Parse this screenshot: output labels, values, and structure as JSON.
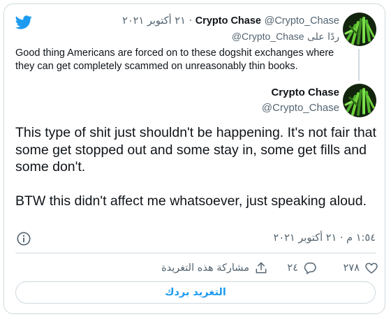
{
  "quoted_tweet": {
    "author_name": "Crypto Chase",
    "author_handle": "@Crypto_Chase",
    "separator": "·",
    "date": "٢١ أكتوبر ٢٠٢١",
    "reply_to_prefix": "ردًا على",
    "reply_to_handle": "@Crypto_Chase",
    "text": "Good thing Americans are forced on to these dogshit exchanges where they can get completely scammed on unreasonably thin books."
  },
  "main_tweet": {
    "author_name": "Crypto Chase",
    "author_handle": "@Crypto_Chase",
    "text": "This type of shit just shouldn't be happening. It's not fair that some get stopped out and some stay in, some get fills and some don't.\n\nBTW this didn't affect me whatsoever, just speaking aloud.",
    "timestamp": "١:٥٤ م · ٢١ أكتوبر ٢٠٢١"
  },
  "actions": {
    "likes": "٢٧٨",
    "replies": "٢٤",
    "share_label": "مشاركة هذه التغريدة"
  },
  "reply_button_label": "التغريد بردك",
  "icons": {
    "logo": "twitter-bird-icon",
    "info": "info-icon",
    "like": "heart-icon",
    "reply": "reply-bubble-icon",
    "share": "share-icon"
  },
  "colors": {
    "accent": "#1d9bf0",
    "text": "#0f1419",
    "secondary": "#536471",
    "border": "#cfd9de"
  }
}
